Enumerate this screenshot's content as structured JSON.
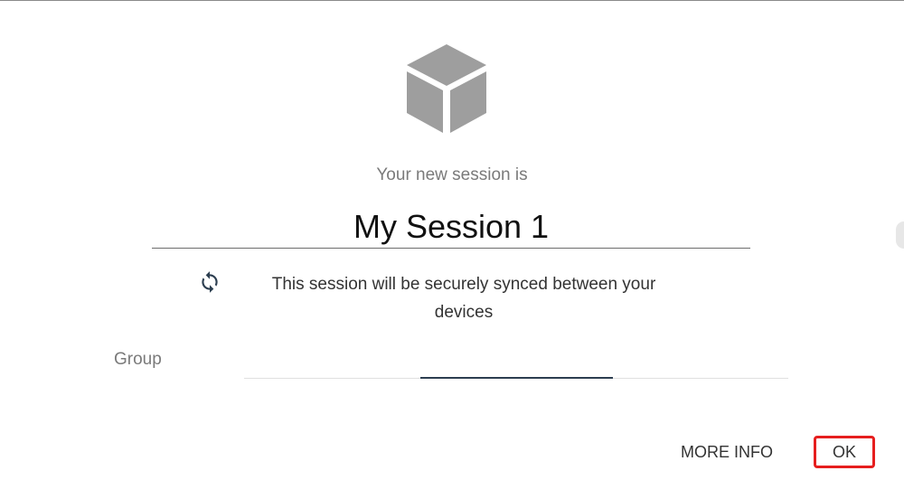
{
  "dialog": {
    "icon": "cube-icon",
    "subtitle": "Your new session is",
    "session_name": "My Session 1",
    "sync": {
      "icon": "sync-icon",
      "text": "This session will be securely synced between your devices"
    },
    "group": {
      "label": "Group",
      "value": ""
    },
    "actions": {
      "more_info_label": "MORE INFO",
      "ok_label": "OK"
    }
  },
  "colors": {
    "cube": "#9e9e9e",
    "sync_icon": "#2c3e50",
    "focus_line": "#2c3e50",
    "highlight": "#e61e1e"
  }
}
